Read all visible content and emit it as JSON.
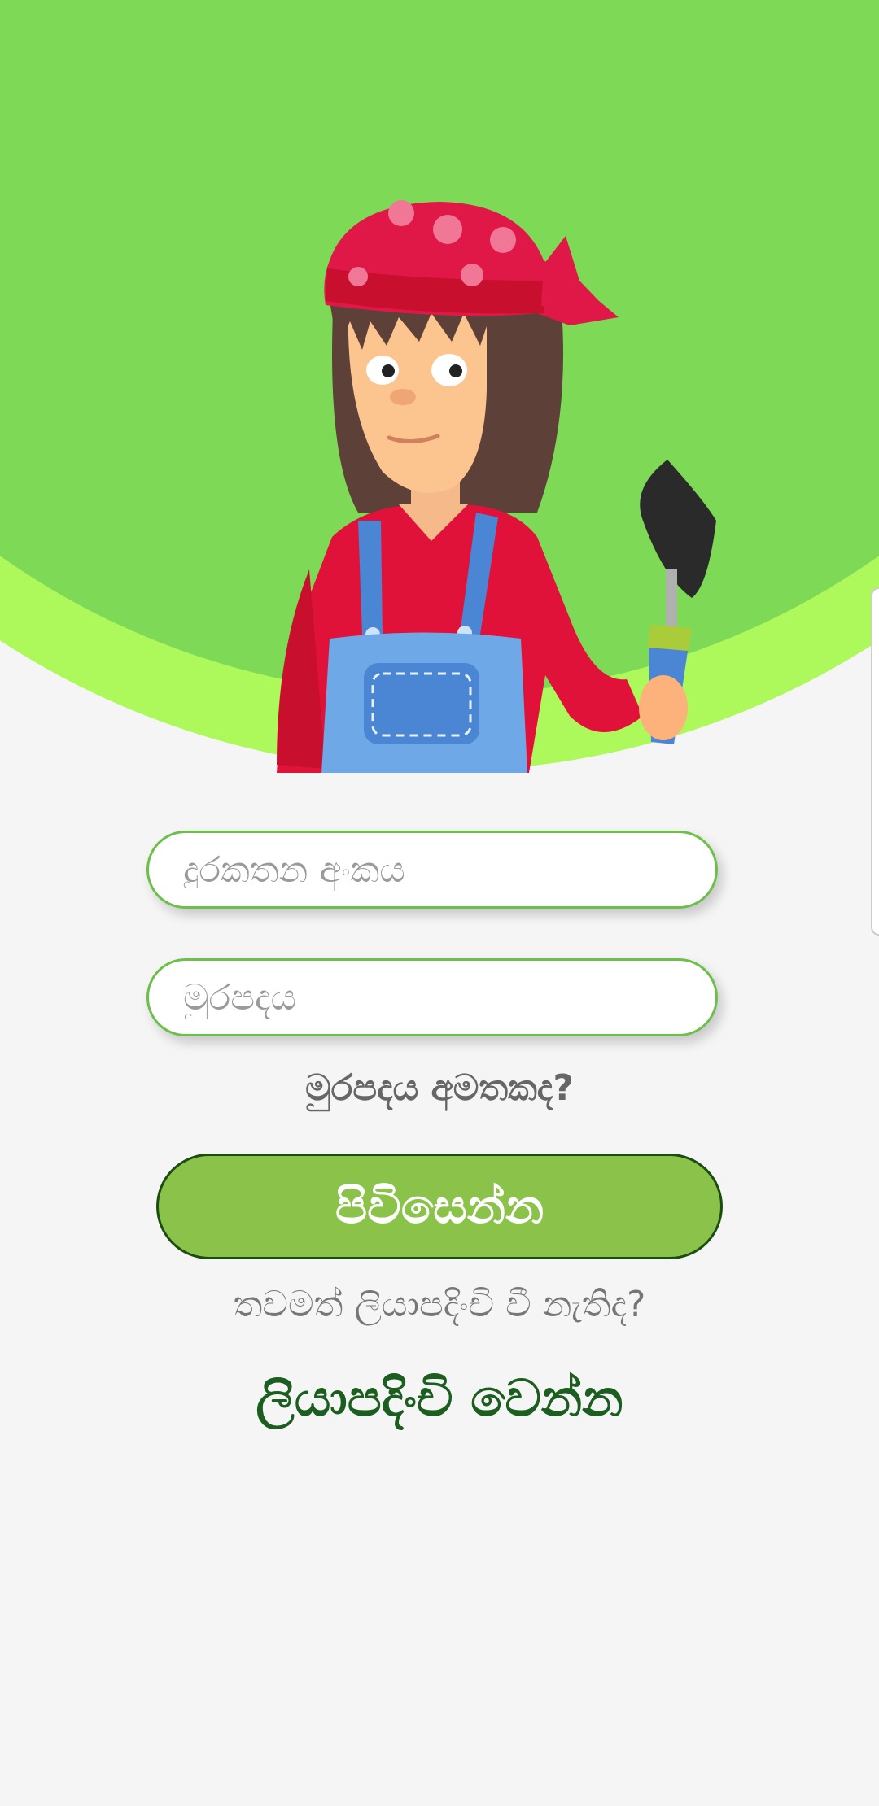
{
  "colors": {
    "background": "#f5f5f5",
    "hero_green": "#7ed957",
    "hero_ring": "#adf85a",
    "field_border": "#6cc04a",
    "button_fill": "#8bc34a",
    "button_border": "#1b4d12",
    "register_text": "#1b5e20"
  },
  "hero": {
    "illustration": "gardener-girl-with-trowel"
  },
  "form": {
    "phone_placeholder": "දුරකතන අංකය",
    "password_placeholder": "මුරපදය",
    "forgot_password": "මුරපදය අමතකද?",
    "login_button": "පිවිසෙන්න",
    "not_registered": "තවමත් ලියාපදිංචි වී නැතිද?",
    "register_link": "ලියාපදිංචි වෙන්න"
  }
}
